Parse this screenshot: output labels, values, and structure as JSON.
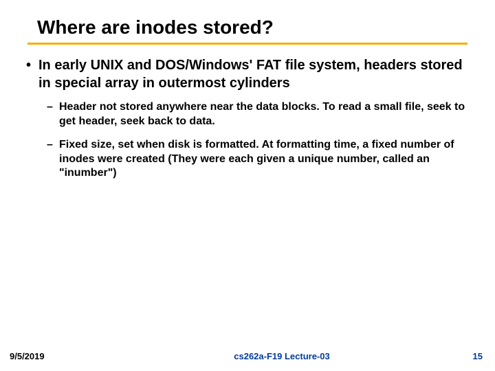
{
  "title": "Where are inodes stored?",
  "bullets": {
    "main": "In early UNIX and DOS/Windows' FAT file system, headers stored in special array in outermost cylinders",
    "sub1": "Header not stored anywhere near the data blocks. To read a small file, seek to get header, seek back to data.",
    "sub2": "Fixed size, set when disk is formatted. At formatting time, a fixed number of inodes were created (They were each given a unique number, called an \"inumber\")"
  },
  "footer": {
    "date": "9/5/2019",
    "center": "cs262a-F19 Lecture-03",
    "page": "15"
  }
}
